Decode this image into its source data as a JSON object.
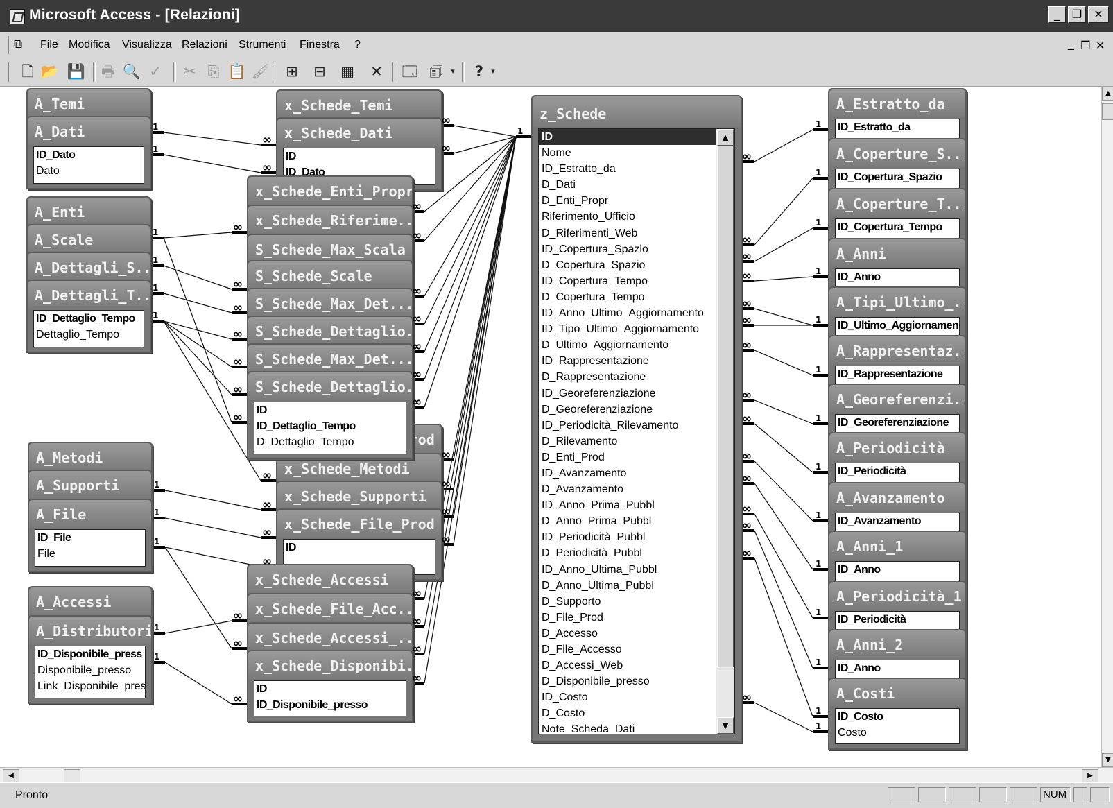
{
  "window": {
    "title": "Microsoft Access - [Relazioni]",
    "controls": [
      "_",
      "❐",
      "✕"
    ],
    "mdi_controls": [
      "_",
      "❐",
      "✕"
    ]
  },
  "menu": [
    {
      "label": "File"
    },
    {
      "label": "Modifica"
    },
    {
      "label": "Visualizza"
    },
    {
      "label": "Relazioni"
    },
    {
      "label": "Strumenti"
    },
    {
      "label": "Finestra"
    },
    {
      "label": "?"
    }
  ],
  "toolbar": {
    "buttons": [
      {
        "name": "new-icon",
        "glyph": "🗋"
      },
      {
        "name": "open-icon",
        "glyph": "📂"
      },
      {
        "name": "save-icon",
        "glyph": "💾"
      },
      {
        "name": "print-icon",
        "glyph": "🖶"
      },
      {
        "name": "print-preview-icon",
        "glyph": "🔍"
      },
      {
        "name": "spelling-icon",
        "glyph": "✓"
      },
      {
        "name": "cut-icon",
        "glyph": "✂"
      },
      {
        "name": "copy-icon",
        "glyph": "⎘"
      },
      {
        "name": "paste-icon",
        "glyph": "📋"
      },
      {
        "name": "format-painter-icon",
        "glyph": "🖌"
      },
      {
        "name": "show-table-icon",
        "glyph": "⊞"
      },
      {
        "name": "show-direct-icon",
        "glyph": "⊟"
      },
      {
        "name": "show-all-icon",
        "glyph": "▦"
      },
      {
        "name": "delete-icon",
        "glyph": "✕"
      },
      {
        "name": "database-window-icon",
        "glyph": "🗔"
      },
      {
        "name": "new-object-icon",
        "glyph": "🗊"
      },
      {
        "name": "help-icon",
        "glyph": "?"
      }
    ]
  },
  "tables": {
    "A_Temi": {
      "title": "A_Temi",
      "fields": []
    },
    "A_Dati": {
      "title": "A_Dati",
      "fields": [
        "ID_Dato",
        "Dato"
      ]
    },
    "A_Enti": {
      "title": "A_Enti",
      "fields": []
    },
    "A_Scale": {
      "title": "A_Scale",
      "fields": []
    },
    "A_Dettagli_S": {
      "title": "A_Dettagli_S...",
      "fields": []
    },
    "A_Dettagli_T": {
      "title": "A_Dettagli_T...",
      "fields": [
        "ID_Dettaglio_Tempo",
        "Dettaglio_Tempo"
      ]
    },
    "A_Metodi": {
      "title": "A_Metodi",
      "fields": []
    },
    "A_Supporti": {
      "title": "A_Supporti",
      "fields": []
    },
    "A_File": {
      "title": "A_File",
      "fields": [
        "ID_File",
        "File"
      ]
    },
    "A_Accessi": {
      "title": "A_Accessi",
      "fields": []
    },
    "A_Distributori": {
      "title": "A_Distributori",
      "fields": [
        "ID_Disponibile_press",
        "Disponibile_presso",
        "Link_Disponibile_pres"
      ]
    },
    "x_Schede_Temi": {
      "title": "x_Schede_Temi",
      "fields": []
    },
    "x_Schede_Dati": {
      "title": "x_Schede_Dati",
      "fields": [
        "ID",
        "ID_Dato"
      ]
    },
    "x_Schede_Enti_Propr": {
      "title": "x_Schede_Enti_Propr",
      "fields": []
    },
    "x_Schede_Riferime": {
      "title": "x_Schede_Riferime...",
      "fields": []
    },
    "S_Schede_Max_Scala": {
      "title": "S_Schede_Max_Scala",
      "fields": []
    },
    "S_Schede_Scale": {
      "title": "S_Schede_Scale",
      "fields": []
    },
    "S_Schede_Max_Det_1": {
      "title": "S_Schede_Max_Det...",
      "fields": []
    },
    "S_Schede_Dettaglio_1": {
      "title": "S_Schede_Dettaglio...",
      "fields": []
    },
    "S_Schede_Max_Det_2": {
      "title": "S_Schede_Max_Det...",
      "fields": []
    },
    "S_Schede_Dettaglio_2": {
      "title": "S_Schede_Dettaglio...",
      "fields": [
        "ID",
        "ID_Dettaglio_Tempo",
        "D_Dettaglio_Tempo"
      ]
    },
    "x_Schede_Enti_Prod": {
      "title": "x_Schede_Enti_Prod",
      "fields": []
    },
    "x_Schede_Metodi": {
      "title": "x_Schede_Metodi",
      "fields": []
    },
    "x_Schede_Supporti": {
      "title": "x_Schede_Supporti",
      "fields": []
    },
    "x_Schede_File_Prod": {
      "title": "x_Schede_File_Prod",
      "fields": [
        "ID"
      ]
    },
    "x_Schede_Accessi": {
      "title": "x_Schede_Accessi",
      "fields": []
    },
    "x_Schede_File_Acc": {
      "title": "x_Schede_File_Acc...",
      "fields": []
    },
    "x_Schede_Accessi_2": {
      "title": "x_Schede_Accessi_...",
      "fields": []
    },
    "x_Schede_Disponibi": {
      "title": "x_Schede_Disponibi...",
      "fields": [
        "ID",
        "ID_Disponibile_presso"
      ]
    },
    "A_Estratto_da": {
      "title": "A_Estratto_da",
      "fields": [
        "ID_Estratto_da"
      ]
    },
    "A_Coperture_S": {
      "title": "A_Coperture_S...",
      "fields": [
        "ID_Copertura_Spazio"
      ]
    },
    "A_Coperture_T": {
      "title": "A_Coperture_T...",
      "fields": [
        "ID_Copertura_Tempo"
      ]
    },
    "A_Anni": {
      "title": "A_Anni",
      "fields": [
        "ID_Anno"
      ]
    },
    "A_Tipi_Ultimo": {
      "title": "A_Tipi_Ultimo_...",
      "fields": [
        "ID_Ultimo_Aggiornamen"
      ]
    },
    "A_Rappresentaz": {
      "title": "A_Rappresentaz...",
      "fields": [
        "ID_Rappresentazione"
      ]
    },
    "A_Georeferenzi": {
      "title": "A_Georeferenzi...",
      "fields": [
        "ID_Georeferenziazione"
      ]
    },
    "A_Periodicita": {
      "title": "A_Periodicità",
      "fields": [
        "ID_Periodicità"
      ]
    },
    "A_Avanzamento": {
      "title": "A_Avanzamento",
      "fields": [
        "ID_Avanzamento"
      ]
    },
    "A_Anni_1": {
      "title": "A_Anni_1",
      "fields": [
        "ID_Anno"
      ]
    },
    "A_Periodicita_1": {
      "title": "A_Periodicità_1",
      "fields": [
        "ID_Periodicità"
      ]
    },
    "A_Anni_2": {
      "title": "A_Anni_2",
      "fields": [
        "ID_Anno"
      ]
    },
    "A_Costi": {
      "title": "A_Costi",
      "fields": [
        "ID_Costo",
        "Costo"
      ]
    },
    "z_Schede": {
      "title": "z_Schede",
      "fields": [
        "ID",
        "Nome",
        "ID_Estratto_da",
        "D_Dati",
        "D_Enti_Propr",
        "Riferimento_Ufficio",
        "D_Riferimenti_Web",
        "ID_Copertura_Spazio",
        "D_Copertura_Spazio",
        "ID_Copertura_Tempo",
        "D_Copertura_Tempo",
        "ID_Anno_Ultimo_Aggiornamento",
        "ID_Tipo_Ultimo_Aggiornamento",
        "D_Ultimo_Aggiornamento",
        "ID_Rappresentazione",
        "D_Rappresentazione",
        "ID_Georeferenziazione",
        "D_Georeferenziazione",
        "ID_Periodicità_Rilevamento",
        "D_Rilevamento",
        "D_Enti_Prod",
        "ID_Avanzamento",
        "D_Avanzamento",
        "ID_Anno_Prima_Pubbl",
        "D_Anno_Prima_Pubbl",
        "ID_Periodicità_Pubbl",
        "D_Periodicità_Pubbl",
        "ID_Anno_Ultima_Pubbl",
        "D_Anno_Ultima_Pubbl",
        "D_Supporto",
        "D_File_Prod",
        "D_Accesso",
        "D_File_Accesso",
        "D_Accessi_Web",
        "D_Disponibile_presso",
        "ID_Costo",
        "D_Costo",
        "Note_Scheda_Dati"
      ],
      "selected": "ID"
    }
  },
  "relationship_labels": {
    "one": "1",
    "many": "∞"
  },
  "status": {
    "text": "Pronto",
    "num": "NUM"
  }
}
